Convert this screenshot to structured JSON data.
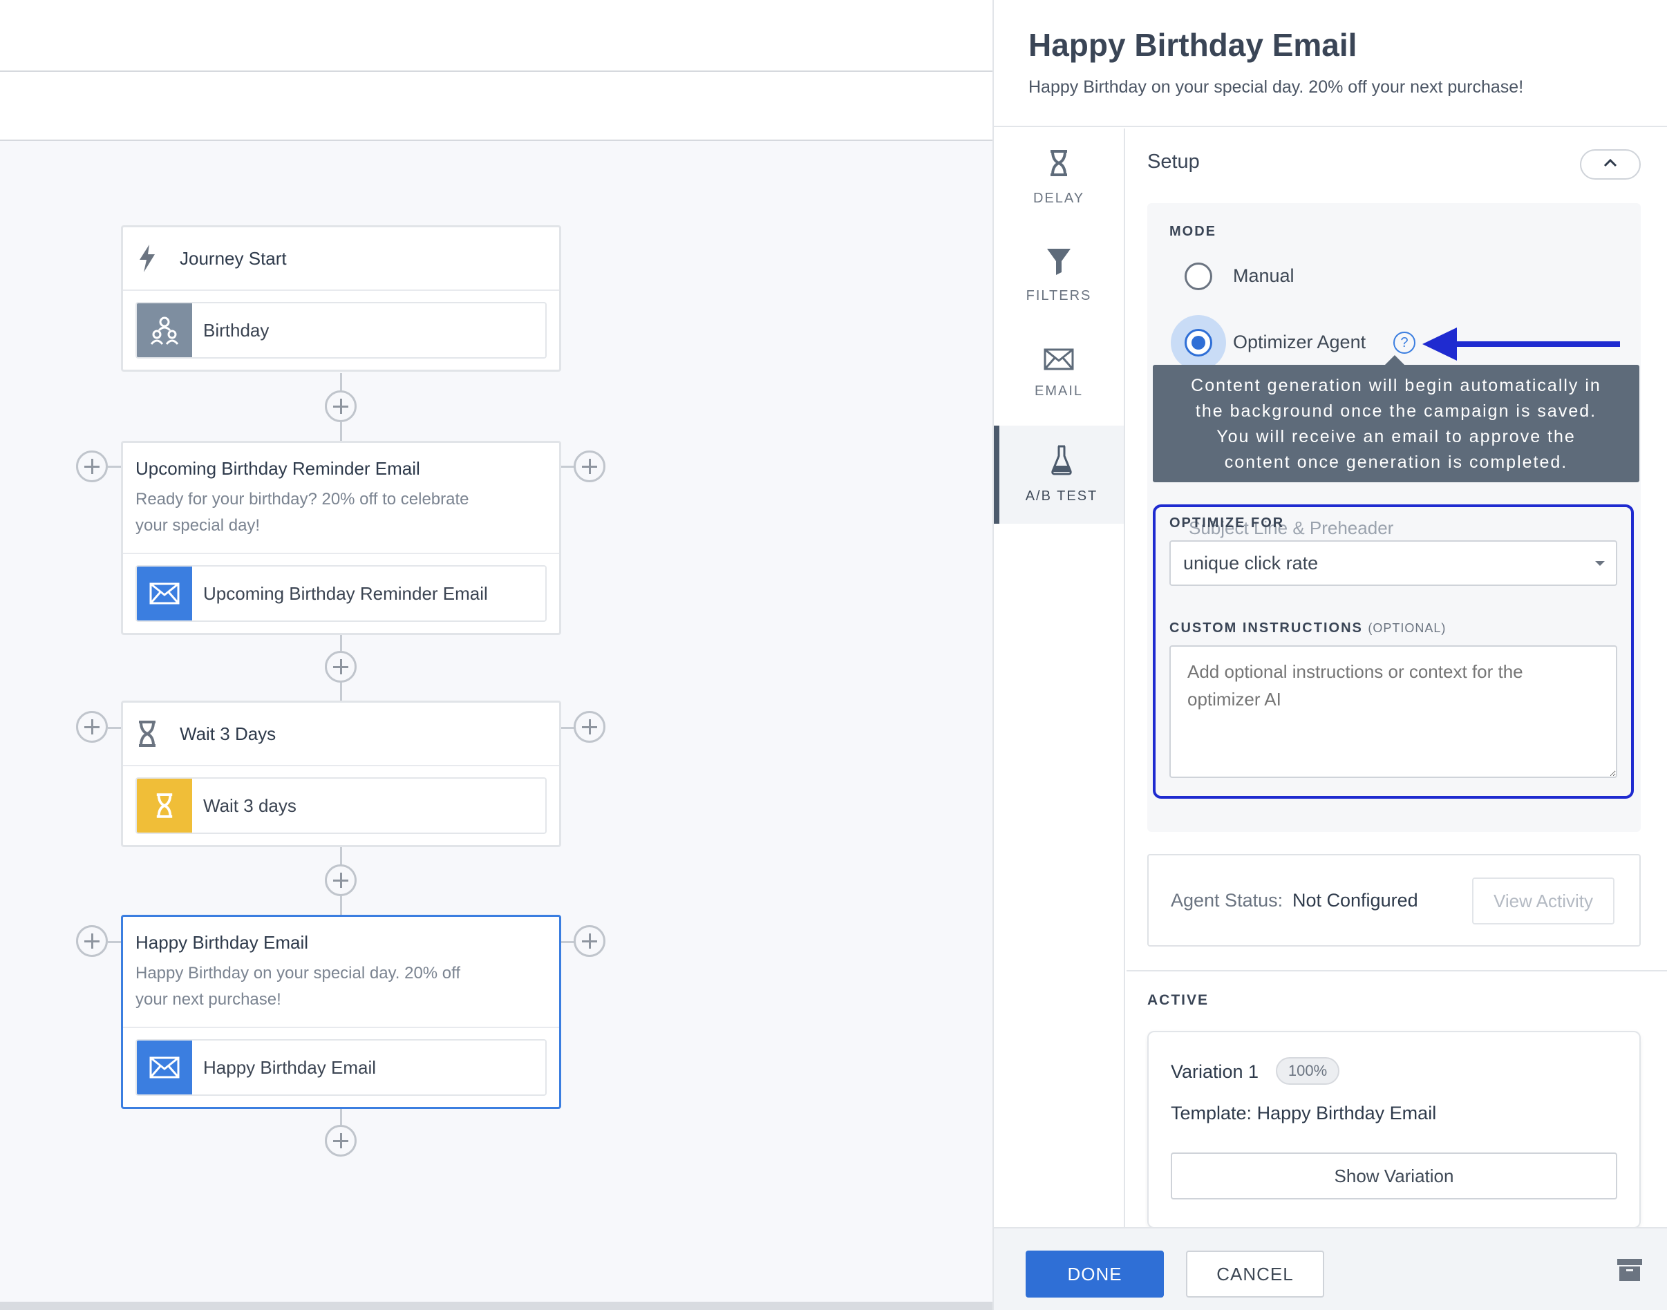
{
  "journey": {
    "start": {
      "title": "Journey Start",
      "trigger": "Birthday"
    },
    "reminder": {
      "title": "Upcoming Birthday Reminder Email",
      "desc_line1": "Ready for your birthday? 20% off to celebrate",
      "desc_line2": "your special day!",
      "item": "Upcoming Birthday Reminder Email"
    },
    "wait": {
      "title": "Wait 3 Days",
      "item": "Wait 3 days"
    },
    "birthday": {
      "title": "Happy Birthday Email",
      "desc_line1": "Happy Birthday on your special day. 20% off",
      "desc_line2": "your next purchase!",
      "item": "Happy Birthday Email"
    }
  },
  "panel": {
    "title": "Happy Birthday Email",
    "subtitle": "Happy Birthday on your special day. 20% off your next purchase!",
    "nav": [
      {
        "label": "DELAY",
        "icon": "hourglass-icon"
      },
      {
        "label": "FILTERS",
        "icon": "funnel-icon"
      },
      {
        "label": "EMAIL",
        "icon": "envelope-icon"
      },
      {
        "label": "A/B TEST",
        "icon": "flask-icon",
        "active": true
      }
    ],
    "setup": {
      "title": "Setup",
      "mode_label": "MODE",
      "mode_options": [
        "Manual",
        "Optimizer Agent"
      ],
      "mode_selected": "Optimizer Agent",
      "ghost_text": "Subject Line & Preheader",
      "tooltip": {
        "line1": "Content generation will begin automatically in",
        "line2": "the background once the campaign is saved.",
        "line3": "You will receive an email to approve the",
        "line4": "content once generation is completed."
      },
      "optimize_for_label": "OPTIMIZE FOR",
      "optimize_for_value": "unique click rate",
      "custom_instructions_label": "CUSTOM INSTRUCTIONS",
      "custom_instructions_optional": "(OPTIONAL)",
      "custom_instructions_placeholder": "Add optional instructions or context for the optimizer AI"
    },
    "status": {
      "label": "Agent Status:",
      "value": "Not Configured",
      "view_button": "View Activity"
    },
    "active": {
      "label": "ACTIVE",
      "variation_name": "Variation 1",
      "variation_percent": "100%",
      "template_label": "Template:",
      "template_value": "Happy Birthday Email",
      "show_button": "Show Variation"
    },
    "footer": {
      "done": "DONE",
      "cancel": "CANCEL"
    }
  },
  "colors": {
    "accent": "#2f6fd6",
    "highlight": "#1f2bd0",
    "wait_tile": "#f0be38",
    "email_tile": "#3b7ee0"
  }
}
